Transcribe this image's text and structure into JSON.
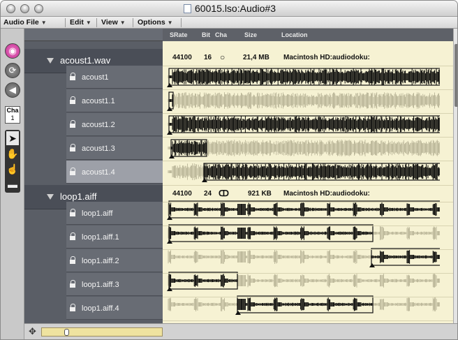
{
  "window": {
    "title": "60015.lso:Audio#3"
  },
  "menubar": [
    {
      "label": "Audio File"
    },
    {
      "label": "Edit"
    },
    {
      "label": "View"
    },
    {
      "label": "Options"
    }
  ],
  "columns": [
    "SRate",
    "Bit",
    "Cha",
    "Size",
    "Location"
  ],
  "toolbar": {
    "cha_label": "Cha",
    "cha_value": "1"
  },
  "files": [
    {
      "name": "acoust1.wav",
      "srate": "44100",
      "bit": "16",
      "cha_symbol": "○",
      "size": "21,4 MB",
      "location": "Macintosh HD:audiodoku:",
      "regions": [
        {
          "name": "acoust1",
          "selected": false
        },
        {
          "name": "acoust1.1",
          "selected": false
        },
        {
          "name": "acoust1.2",
          "selected": false
        },
        {
          "name": "acoust1.3",
          "selected": false
        },
        {
          "name": "acoust1.4",
          "selected": true
        }
      ]
    },
    {
      "name": "loop1.aiff",
      "srate": "44100",
      "bit": "24",
      "cha_symbol": "ↀ",
      "size": "921 KB",
      "location": "Macintosh HD:audiodoku:",
      "regions": [
        {
          "name": "loop1.aiff",
          "selected": false
        },
        {
          "name": "loop1.aiff.1",
          "selected": false
        },
        {
          "name": "loop1.aiff.2",
          "selected": false
        },
        {
          "name": "loop1.aiff.3",
          "selected": false
        },
        {
          "name": "loop1.aiff.4",
          "selected": false
        }
      ]
    }
  ],
  "icons": {
    "record": "record-icon",
    "cycle": "cycle-icon",
    "speaker": "speaker-icon",
    "pointer": "pointer-tool-icon",
    "hand": "hand-tool-icon",
    "finger": "finger-tool-icon",
    "eraser": "eraser-tool-icon",
    "zoom": "zoom-icon"
  },
  "colors": {
    "list_bg": "#5a5e66",
    "region_cell": "#686c74",
    "region_selected": "#9da0a8",
    "waveform_bg": "#f6f2d3",
    "record": "#d445a8"
  }
}
